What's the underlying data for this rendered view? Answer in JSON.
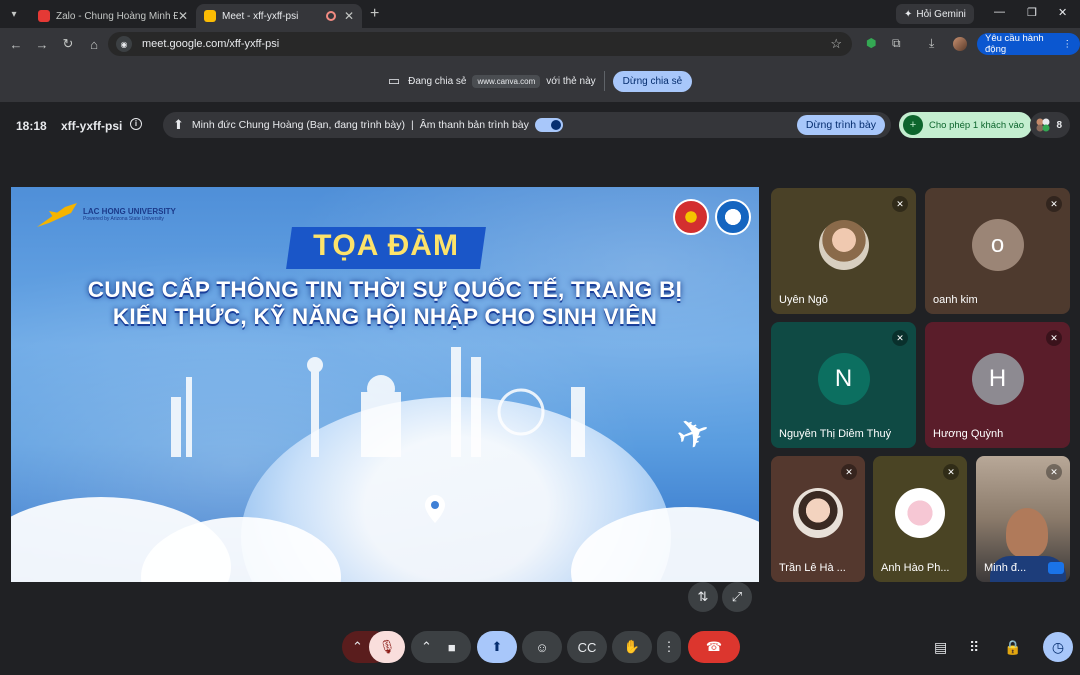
{
  "browser": {
    "tabs": [
      {
        "title": "Zalo - Chung Hoàng Minh Đức",
        "active": false,
        "favicon_color": "#e53935"
      },
      {
        "title": "Meet - xff-yxff-psi",
        "active": true,
        "favicon_color": "#fbbc04",
        "recording": true
      }
    ],
    "gemini_label": "Hỏi Gemini",
    "url": "meet.google.com/xff-yxff-psi",
    "ask_button": "Yêu cầu hành động"
  },
  "sharebar": {
    "prefix": "Đang chia sẻ",
    "site": "www.canva.com",
    "suffix": "với thẻ này",
    "stop_label": "Dừng chia sẻ"
  },
  "meeting": {
    "time": "18:18",
    "code": "xff-yxff-psi",
    "presenting_text": "Minh đức Chung Hoàng (Bạn, đang trình bày)",
    "audio_label": "Âm thanh bản trình bày",
    "stop_presenting_label": "Dừng trình bày",
    "allow_guest_label": "Cho phép 1 khách vào",
    "participant_count": "8"
  },
  "slide": {
    "logo_text": "LAC HONG UNIVERSITY",
    "logo_subtext": "Powered by Arizona State University",
    "event_label": "TỌA ĐÀM",
    "headline_line1": "CUNG CẤP THÔNG TIN THỜI SỰ QUỐC TẾ, TRANG BỊ",
    "headline_line2": "KIẾN THỨC, KỸ NĂNG HỘI NHẬP CHO SINH VIÊN"
  },
  "participants": [
    {
      "name": "Uyên Ngô",
      "bg": "#4a4127",
      "avatar": "photo"
    },
    {
      "name": "oanh kim",
      "bg": "#4e3a2e",
      "avatar": "letter",
      "letter": "o",
      "letter_bg": "#9b8576"
    },
    {
      "name": "Nguyễn Thị Diễm Thuý",
      "bg": "#0f4a44",
      "avatar": "letter",
      "letter": "N",
      "letter_bg": "#0c6f60"
    },
    {
      "name": "Hương Quỳnh",
      "bg": "#5a1d2a",
      "avatar": "letter",
      "letter": "H",
      "letter_bg": "#8d8a91"
    },
    {
      "name": "Trần Lê Hà ...",
      "bg": "#54382e",
      "avatar": "photo"
    },
    {
      "name": "Anh Hào Ph...",
      "bg": "#4a4424",
      "avatar": "photo"
    },
    {
      "name": "Minh đ...",
      "bg": "#7a6a5a",
      "avatar": "camera"
    }
  ],
  "controls": {
    "end_call_color": "#dc362e",
    "mic_muted_color": "#f9dedc",
    "present_color": "#a8c7fa"
  }
}
